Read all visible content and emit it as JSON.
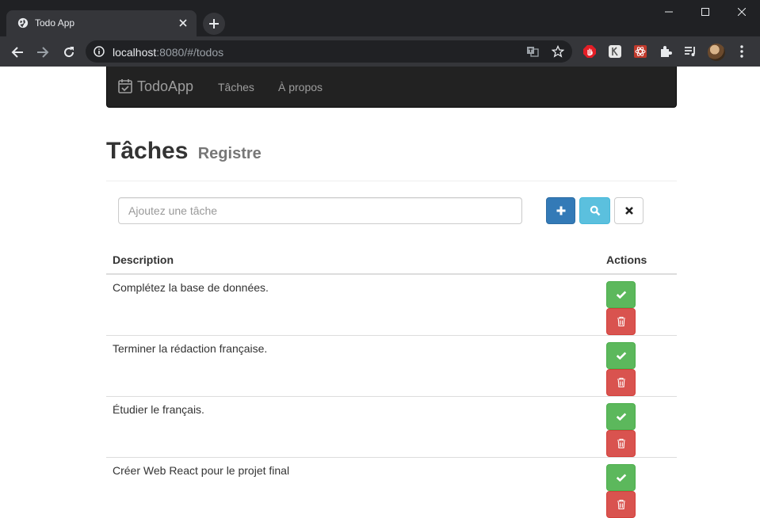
{
  "browser": {
    "tab_title": "Todo App",
    "url_host": "localhost",
    "url_rest": ":8080/#/todos",
    "icons": [
      "globe-icon",
      "close-icon",
      "plus-icon",
      "minimize-icon",
      "maximize-icon",
      "window-close-icon",
      "back-icon",
      "forward-icon",
      "reload-icon",
      "info-icon",
      "translate-icon",
      "star-icon",
      "extension-icons",
      "puzzle-icon",
      "media-icon",
      "profile-avatar",
      "menu-icon"
    ]
  },
  "navbar": {
    "brand": "TodoApp",
    "links": [
      "Tâches",
      "À propos"
    ]
  },
  "header": {
    "title": "Tâches",
    "subtitle": "Registre"
  },
  "form": {
    "placeholder": "Ajoutez une tâche",
    "buttons": [
      "plus-icon",
      "search-icon",
      "times-icon"
    ]
  },
  "table": {
    "headers": {
      "description": "Description",
      "actions": "Actions"
    },
    "rows": [
      {
        "description": "Complétez la base de données."
      },
      {
        "description": "Terminer la rédaction française."
      },
      {
        "description": "Étudier le français."
      },
      {
        "description": "Créer Web React pour le projet final"
      }
    ]
  },
  "colors": {
    "primary": "#337ab7",
    "info": "#5bc0de",
    "success": "#5cb85c",
    "danger": "#d9534f",
    "navbar": "#222222"
  }
}
